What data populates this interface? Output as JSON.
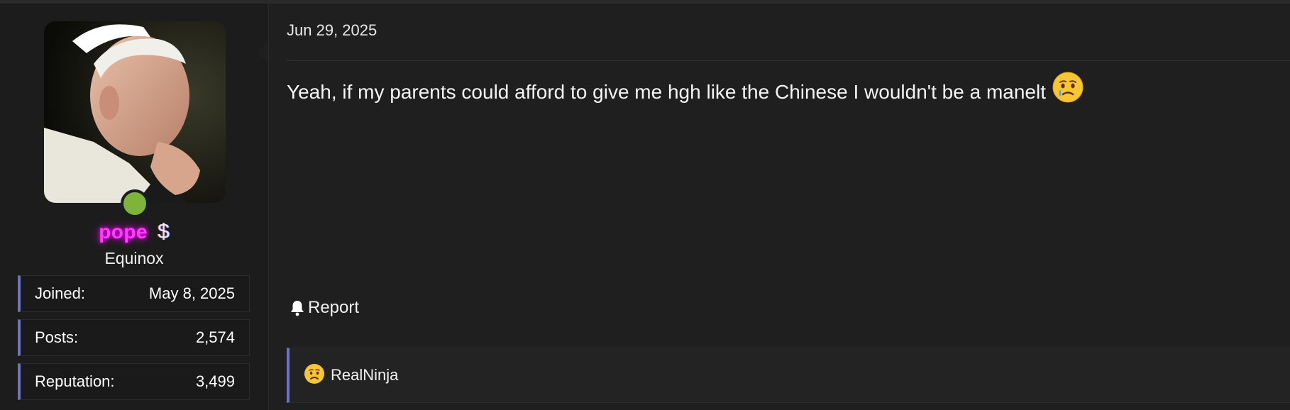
{
  "user": {
    "name": "pope",
    "badge_symbol": "$",
    "title": "Equinox",
    "online": true,
    "stats": [
      {
        "label": "Joined:",
        "value": "May 8, 2025"
      },
      {
        "label": "Posts:",
        "value": "2,574"
      },
      {
        "label": "Reputation:",
        "value": "3,499"
      }
    ]
  },
  "post": {
    "date": "Jun 29, 2025",
    "body": "Yeah, if my parents could afford to give me hgh like the Chinese I wouldn't be a manelt",
    "body_emoji": "crying-face-icon",
    "report_label": "Report"
  },
  "reactions": {
    "emoji": "sad-face-icon",
    "user": "RealNinja"
  },
  "colors": {
    "background": "#1f1f1f",
    "accent": "#6c74c9",
    "online": "#7db53a",
    "username": "#ff3dff"
  }
}
